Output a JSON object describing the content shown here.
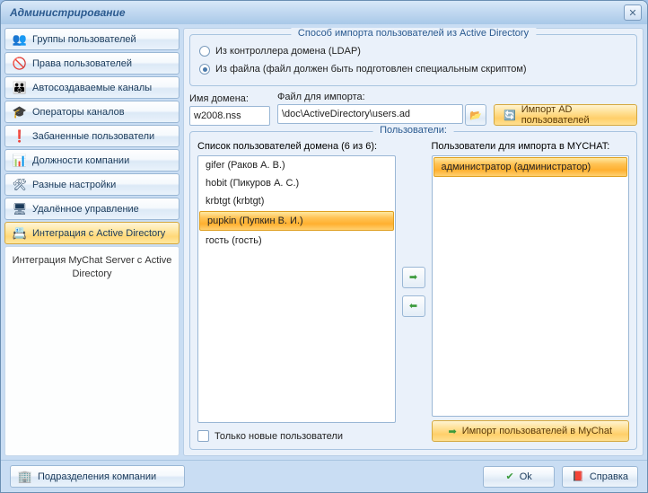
{
  "window": {
    "title": "Администрирование"
  },
  "sidebar": {
    "items": [
      {
        "label": "Группы пользователей",
        "icon": "👥"
      },
      {
        "label": "Права пользователей",
        "icon": "🚫"
      },
      {
        "label": "Автосоздаваемые каналы",
        "icon": "👪"
      },
      {
        "label": "Операторы каналов",
        "icon": "🎓"
      },
      {
        "label": "Забаненные пользователи",
        "icon": "❗"
      },
      {
        "label": "Должности компании",
        "icon": "📊"
      },
      {
        "label": "Разные настройки",
        "icon": "🛠"
      },
      {
        "label": "Удалённое управление",
        "icon": "🖥"
      },
      {
        "label": "Интеграция с Active Directory",
        "icon": "📇"
      }
    ],
    "description": "Интеграция MyChat Server с Active Directory",
    "bottom": {
      "label": "Подразделения компании",
      "icon": "🏢"
    }
  },
  "importMethod": {
    "title": "Способ импорта пользователей из Active Directory",
    "option_ldap": "Из контроллера домена (LDAP)",
    "option_file": "Из файла (файл должен быть подготовлен специальным скриптом)"
  },
  "fields": {
    "domain_label": "Имя домена:",
    "domain_value": "w2008.nss",
    "file_label": "Файл для импорта:",
    "file_value": "\\doc\\ActiveDirectory\\users.ad",
    "browse_icon": "📂",
    "import_btn": "Импорт AD пользователей",
    "import_icon": "🔄"
  },
  "usersBox": {
    "title": "Пользователи:",
    "left_title": "Список пользователей домена (6 из 6):",
    "right_title": "Пользователи для импорта в MYCHAT:",
    "left_items": [
      "gifer (Раков А. В.)",
      "hobit (Пикуров А. С.)",
      "krbtgt (krbtgt)",
      "pupkin (Пупкин В. И.)",
      "гость (гость)"
    ],
    "left_selected_index": 3,
    "right_items": [
      "администратор (администратор)"
    ],
    "right_selected_index": 0,
    "only_new": "Только новые пользователи",
    "import_mychat": "Импорт пользователей в MyChat"
  },
  "footer": {
    "ok": "Ok",
    "ok_icon": "✔",
    "help": "Справка",
    "help_icon": "📕"
  }
}
